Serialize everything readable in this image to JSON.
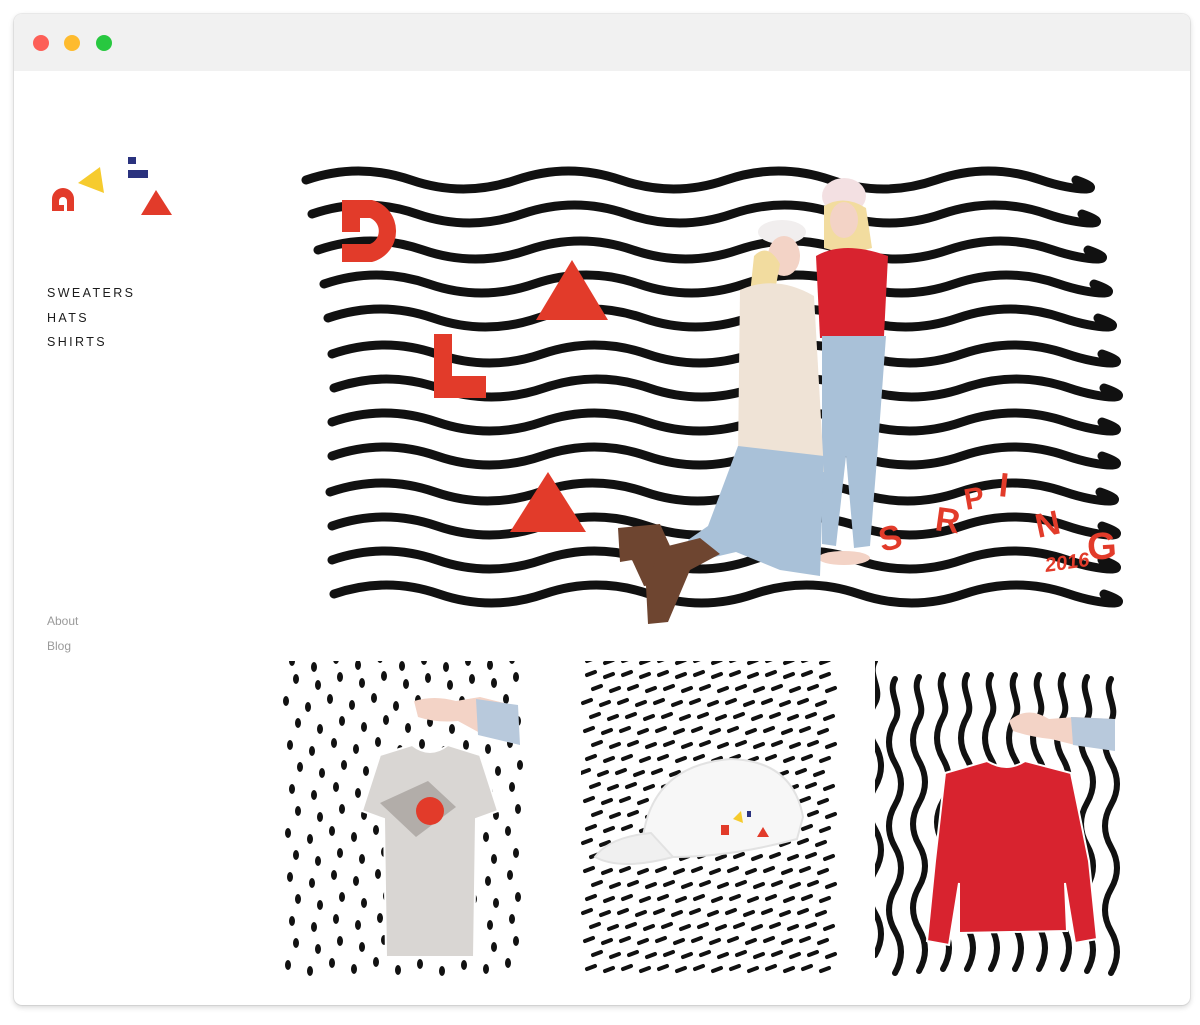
{
  "nav": {
    "primary": [
      {
        "label": "SWEATERS"
      },
      {
        "label": "HATS"
      },
      {
        "label": "SHIRTS"
      }
    ],
    "secondary": [
      {
        "label": "About"
      },
      {
        "label": "Blog"
      }
    ]
  },
  "hero": {
    "season_letters": [
      "S",
      "R",
      "P",
      "I",
      "N",
      "G"
    ],
    "year": "2016"
  },
  "products": [
    {
      "icon": "tshirt-image"
    },
    {
      "icon": "cap-image"
    },
    {
      "icon": "sweater-image"
    }
  ],
  "colors": {
    "brand_red": "#e23b2a",
    "brand_yellow": "#f6cb2e",
    "brand_navy": "#2a327e",
    "ink": "#111111",
    "muted": "#9a9a9a",
    "sweater_red": "#d8232f"
  }
}
